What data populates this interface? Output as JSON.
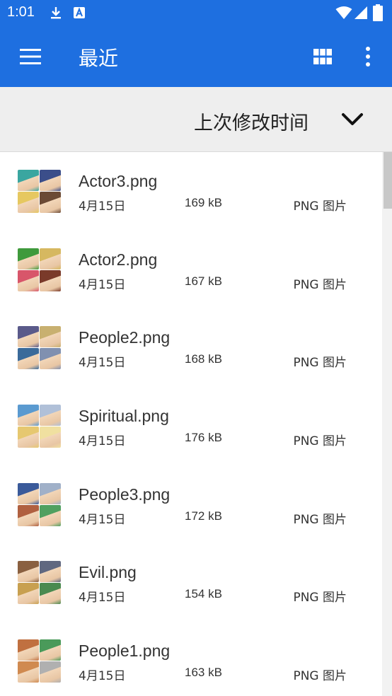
{
  "status_bar": {
    "time": "1:01",
    "icons": [
      "download-icon",
      "a-box-icon",
      "wifi-icon",
      "cell-signal-icon",
      "battery-icon"
    ]
  },
  "app_bar": {
    "title": "最近",
    "icons": [
      "menu-icon",
      "grid-view-icon",
      "more-vert-icon"
    ],
    "color": "#1e6fe0"
  },
  "sort": {
    "label": "上次修改时间",
    "icon": "chevron-down-icon"
  },
  "files": [
    {
      "name": "Actor3.png",
      "date": "4月15日",
      "size": "169 kB",
      "type": "PNG 图片",
      "colors": [
        "#3aa6a0",
        "#3b4e8a",
        "#e6c860",
        "#6b4a35"
      ]
    },
    {
      "name": "Actor2.png",
      "date": "4月15日",
      "size": "167 kB",
      "type": "PNG 图片",
      "colors": [
        "#3f9a3c",
        "#d6b860",
        "#d8566a",
        "#7a3a2a"
      ]
    },
    {
      "name": "People2.png",
      "date": "4月15日",
      "size": "168 kB",
      "type": "PNG 图片",
      "colors": [
        "#5a5a8a",
        "#c8b070",
        "#3a6a9a",
        "#8090b0"
      ]
    },
    {
      "name": "Spiritual.png",
      "date": "4月15日",
      "size": "176 kB",
      "type": "PNG 图片",
      "colors": [
        "#5a9ad0",
        "#b0c0d8",
        "#e6c870",
        "#f0e0a0"
      ]
    },
    {
      "name": "People3.png",
      "date": "4月15日",
      "size": "172 kB",
      "type": "PNG 图片",
      "colors": [
        "#3a5a9a",
        "#a0b0c8",
        "#b06040",
        "#50a060"
      ]
    },
    {
      "name": "Evil.png",
      "date": "4月15日",
      "size": "154 kB",
      "type": "PNG 图片",
      "colors": [
        "#8a6040",
        "#606880",
        "#c8a050",
        "#4a8a50"
      ]
    },
    {
      "name": "People1.png",
      "date": "4月15日",
      "size": "163 kB",
      "type": "PNG 图片",
      "colors": [
        "#c07040",
        "#4a9a5a",
        "#d08a50",
        "#b0b0b0"
      ]
    }
  ]
}
